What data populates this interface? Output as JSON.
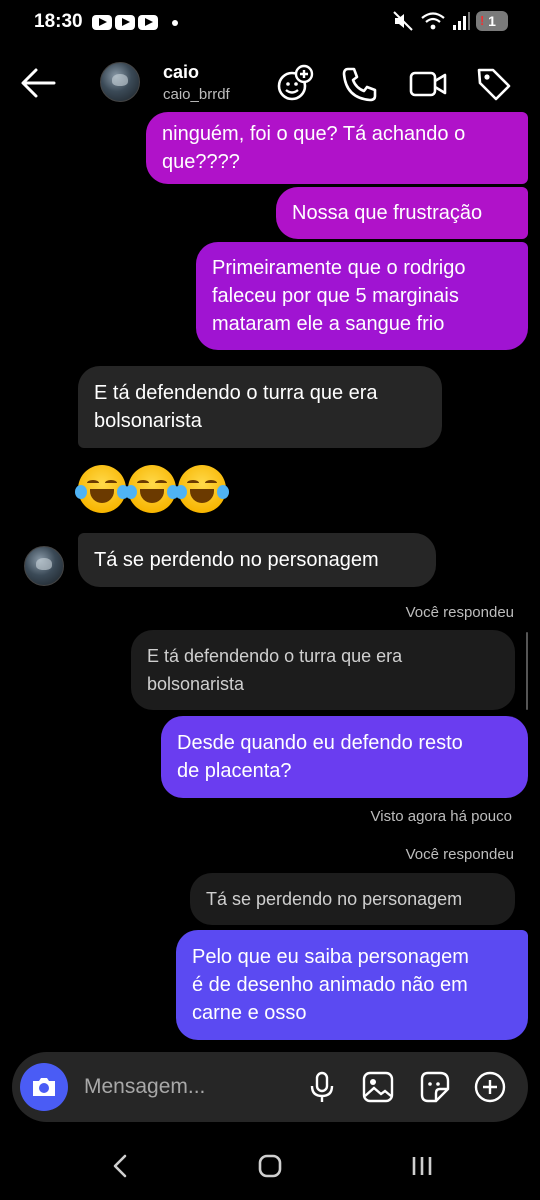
{
  "status": {
    "time": "18:30",
    "battery": "1"
  },
  "header": {
    "name": "caio",
    "username": "caio_brrdf"
  },
  "messages": {
    "m1": [
      "ninguém, foi o que? Tá achando o",
      "que????"
    ],
    "m2": "Nossa que frustração",
    "m3": [
      "Primeiramente que o rodrigo",
      "faleceu por que 5 marginais",
      "mataram ele a sangue frio"
    ],
    "m4": [
      "E tá defendendo o turra que era",
      "bolsonarista"
    ],
    "m5": "Tá se perdendo no personagem",
    "reply1_label": "Você respondeu",
    "reply1_quote": [
      "E tá defendendo o turra que era",
      "bolsonarista"
    ],
    "m6": [
      "Desde quando eu defendo resto",
      "de placenta?"
    ],
    "seen": "Visto agora há pouco",
    "reply2_label": "Você respondeu",
    "reply2_quote": "Tá se perdendo no personagem",
    "m7": [
      "Pelo que eu saiba personagem",
      "é de desenho animado não em",
      "carne e osso"
    ]
  },
  "composer": {
    "placeholder": "Mensagem..."
  },
  "colors": {
    "sent_pink": "#b012c9",
    "sent_purple": "#6e3cf0",
    "received": "#262626",
    "camera": "#4a5cf5"
  },
  "icons": [
    "back-arrow-icon",
    "add-people-icon",
    "phone-icon",
    "video-icon",
    "tag-icon",
    "camera-icon",
    "microphone-icon",
    "image-icon",
    "sticker-icon",
    "plus-icon",
    "nav-back-icon",
    "nav-home-icon",
    "nav-recents-icon"
  ]
}
